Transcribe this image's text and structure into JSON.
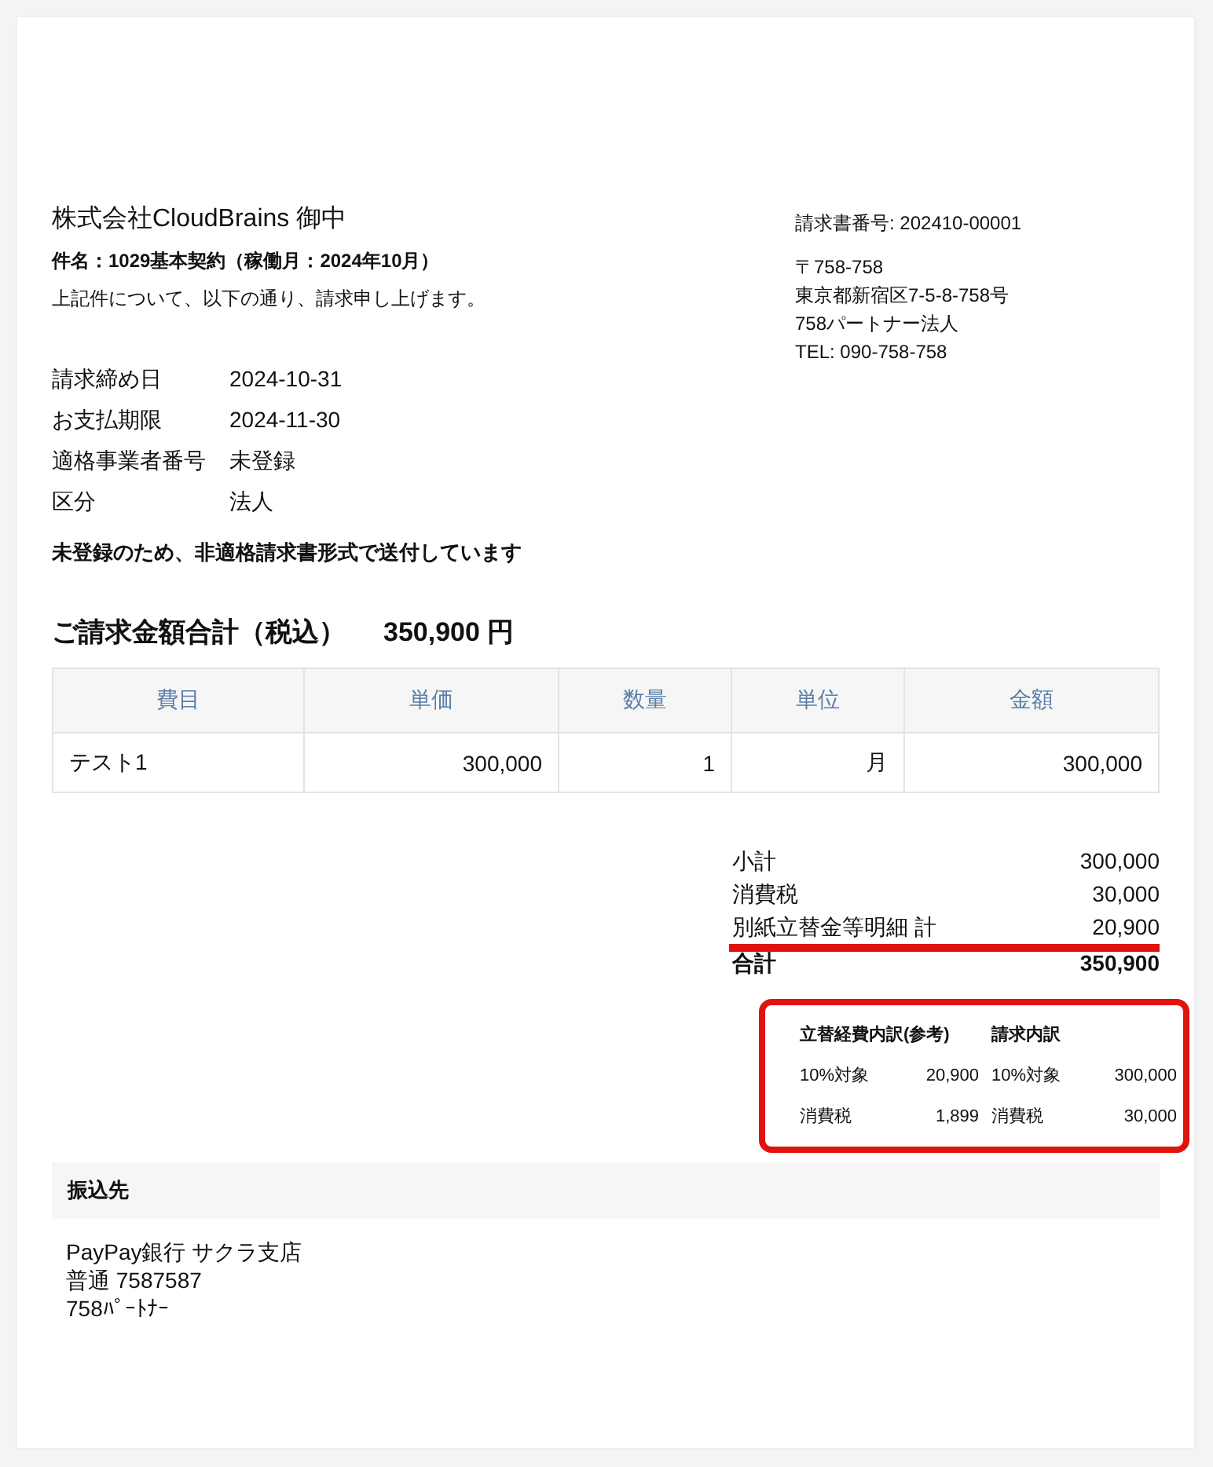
{
  "recipient": "株式会社CloudBrains 御中",
  "subject": "件名：1029基本契約（稼働月：2024年10月）",
  "intro": "上記件について、以下の通り、請求申し上げます。",
  "invoice_number": "請求書番号: 202410-00001",
  "sender": [
    "〒758-758",
    "東京都新宿区7-5-8-758号",
    "758パートナー法人",
    "TEL: 090-758-758"
  ],
  "details": [
    {
      "label": "請求締め日",
      "value": "2024-10-31"
    },
    {
      "label": "お支払期限",
      "value": "2024-11-30"
    },
    {
      "label": "適格事業者番号",
      "value": "未登録"
    },
    {
      "label": "区分",
      "value": "法人"
    }
  ],
  "notice": "未登録のため、非適格請求書形式で送付しています",
  "total_label": "ご請求金額合計（税込）",
  "total_amount": "350,900 円",
  "table": {
    "columns": [
      "費目",
      "単価",
      "数量",
      "単位",
      "金額"
    ],
    "rows": [
      [
        "テスト1",
        "300,000",
        "1",
        "月",
        "300,000"
      ]
    ]
  },
  "summary": [
    {
      "label": "小計",
      "value": "300,000",
      "bold": false,
      "highlighted": false
    },
    {
      "label": "消費税",
      "value": "30,000",
      "bold": false,
      "highlighted": false
    },
    {
      "label": "別紙立替金等明細 計",
      "value": "20,900",
      "bold": false,
      "highlighted": true
    },
    {
      "label": "合計",
      "value": "350,900",
      "bold": true,
      "highlighted": false
    }
  ],
  "breakdown": {
    "highlighted": true,
    "headers": [
      "立替経費内訳(参考)",
      "請求内訳"
    ],
    "rows": [
      [
        "10%対象",
        "20,900",
        "10%対象",
        "300,000"
      ],
      [
        "消費税",
        "1,899",
        "消費税",
        "30,000"
      ]
    ]
  },
  "bank": {
    "title": "振込先",
    "lines": [
      "PayPay銀行 サクラ支店",
      "普通 7587587",
      "758ﾊﾟｰﾄﾅｰ"
    ]
  }
}
